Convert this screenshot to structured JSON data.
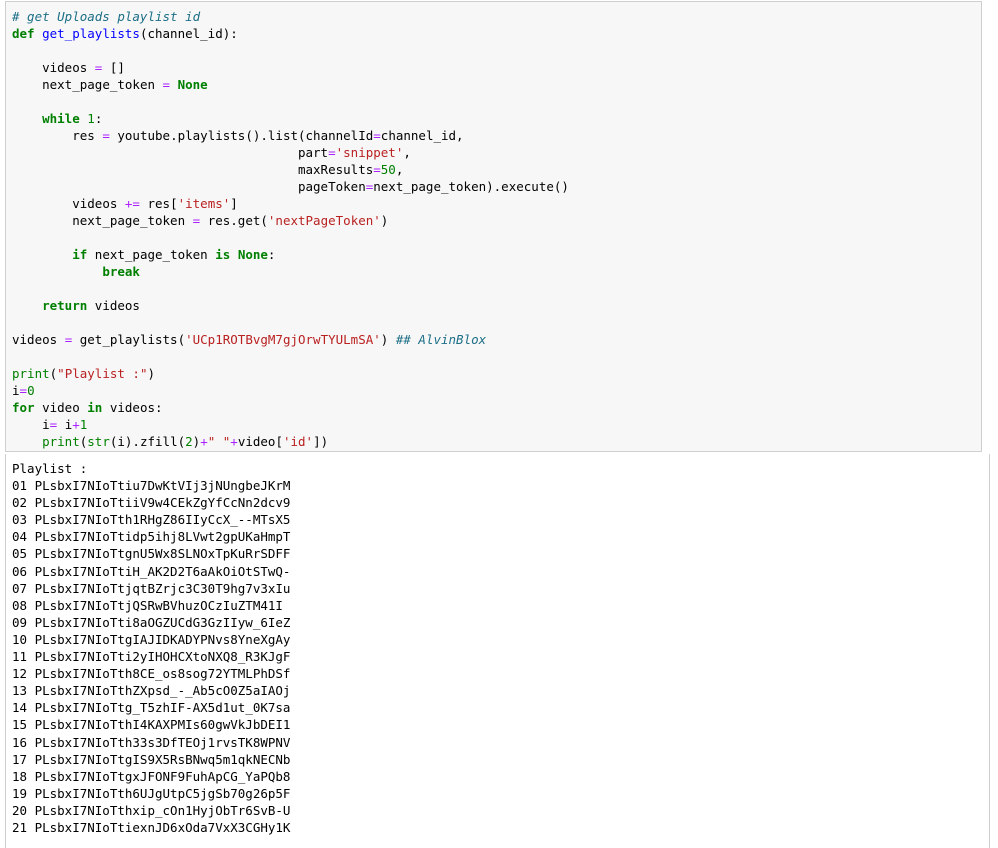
{
  "code_cell": {
    "l1": "# get Uploads playlist id",
    "l2_def": "def",
    "l2_fn": "get_playlists",
    "l2_rest": "(channel_id):",
    "l4_var": "videos ",
    "l4_op": "=",
    "l4_rest": " []",
    "l5_var": "next_page_token ",
    "l5_op": "=",
    "l5_none": "None",
    "l7_kw": "while",
    "l7_num": "1",
    "l7_rest": ":",
    "l8_a": "res ",
    "l8_op": "=",
    "l8_b": " youtube.playlists().list(channelId",
    "l8_op2": "=",
    "l8_c": "channel_id,",
    "l9_a": "part",
    "l9_op": "=",
    "l9_str": "'snippet'",
    "l9_c": ",",
    "l10_a": "maxResults",
    "l10_op": "=",
    "l10_num": "50",
    "l10_c": ",",
    "l11_a": "pageToken",
    "l11_op": "=",
    "l11_c": "next_page_token).execute()",
    "l12_a": "videos ",
    "l12_op": "+=",
    "l12_b": " res[",
    "l12_str": "'items'",
    "l12_c": "]",
    "l13_a": "next_page_token ",
    "l13_op": "=",
    "l13_b": " res.get(",
    "l13_str": "'nextPageToken'",
    "l13_c": ")",
    "l15_kw": "if",
    "l15_b": " next_page_token ",
    "l15_kw2": "is",
    "l15_none": "None",
    "l15_c": ":",
    "l16_kw": "break",
    "l18_kw": "return",
    "l18_b": " videos",
    "l20_a": "videos ",
    "l20_op": "=",
    "l20_b": " get_playlists(",
    "l20_str": "'UCp1ROTBvgM7gjOrwTYULmSA'",
    "l20_c": ") ",
    "l20_cm": "## AlvinBlox",
    "l22_bi": "print",
    "l22_b": "(",
    "l22_str": "\"Playlist :\"",
    "l22_c": ")",
    "l23_a": "i",
    "l23_op": "=",
    "l23_num": "0",
    "l24_kw": "for",
    "l24_b": " video ",
    "l24_kw2": "in",
    "l24_c": " videos:",
    "l25_a": "i",
    "l25_op": "=",
    "l25_b": " i",
    "l25_op2": "+",
    "l25_num": "1",
    "l26_bi": "print",
    "l26_b": "(",
    "l26_bi2": "str",
    "l26_c": "(i).zfill(",
    "l26_num": "2",
    "l26_d": ")",
    "l26_op": "+",
    "l26_str": "\" \"",
    "l26_op2": "+",
    "l26_e": "video[",
    "l26_str2": "'id'",
    "l26_f": "])"
  },
  "output": {
    "header": "Playlist :",
    "lines": [
      "01 PLsbxI7NIoTtiu7DwKtVIj3jNUngbeJKrM",
      "02 PLsbxI7NIoTtiiV9w4CEkZgYfCcNn2dcv9",
      "03 PLsbxI7NIoTth1RHgZ86IIyCcX_--MTsX5",
      "04 PLsbxI7NIoTtidp5ihj8LVwt2gpUKaHmpT",
      "05 PLsbxI7NIoTtgnU5Wx8SLNOxTpKuRrSDFF",
      "06 PLsbxI7NIoTtiH_AK2D2T6aAkOiOtSTwQ-",
      "07 PLsbxI7NIoTtjqtBZrjc3C30T9hg7v3xIu",
      "08 PLsbxI7NIoTtjQSRwBVhuzOCzIuZTM41I",
      "09 PLsbxI7NIoTti8aOGZUCdG3GzIIyw_6IeZ",
      "10 PLsbxI7NIoTtgIAJIDKADYPNvs8YneXgAy",
      "11 PLsbxI7NIoTti2yIHOHCXtoNXQ8_R3KJgF",
      "12 PLsbxI7NIoTth8CE_os8sog72YTMLPhDSf",
      "13 PLsbxI7NIoTthZXpsd_-_Ab5cO0Z5aIAOj",
      "14 PLsbxI7NIoTtg_T5zhIF-AX5d1ut_0K7sa",
      "15 PLsbxI7NIoTthI4KAXPMIs60gwVkJbDEI1",
      "16 PLsbxI7NIoTth33s3DfTEOj1rvsTK8WPNV",
      "17 PLsbxI7NIoTtgIS9X5RsBNwq5m1qkNECNb",
      "18 PLsbxI7NIoTtgxJFONF9FuhApCG_YaPQb8",
      "19 PLsbxI7NIoTth6UJgUtpC5jgSb70g26p5F",
      "20 PLsbxI7NIoTthxip_cOn1HyjObTr6SvB-U",
      "21 PLsbxI7NIoTtiexnJD6xOda7VxX3CGHy1K"
    ]
  }
}
